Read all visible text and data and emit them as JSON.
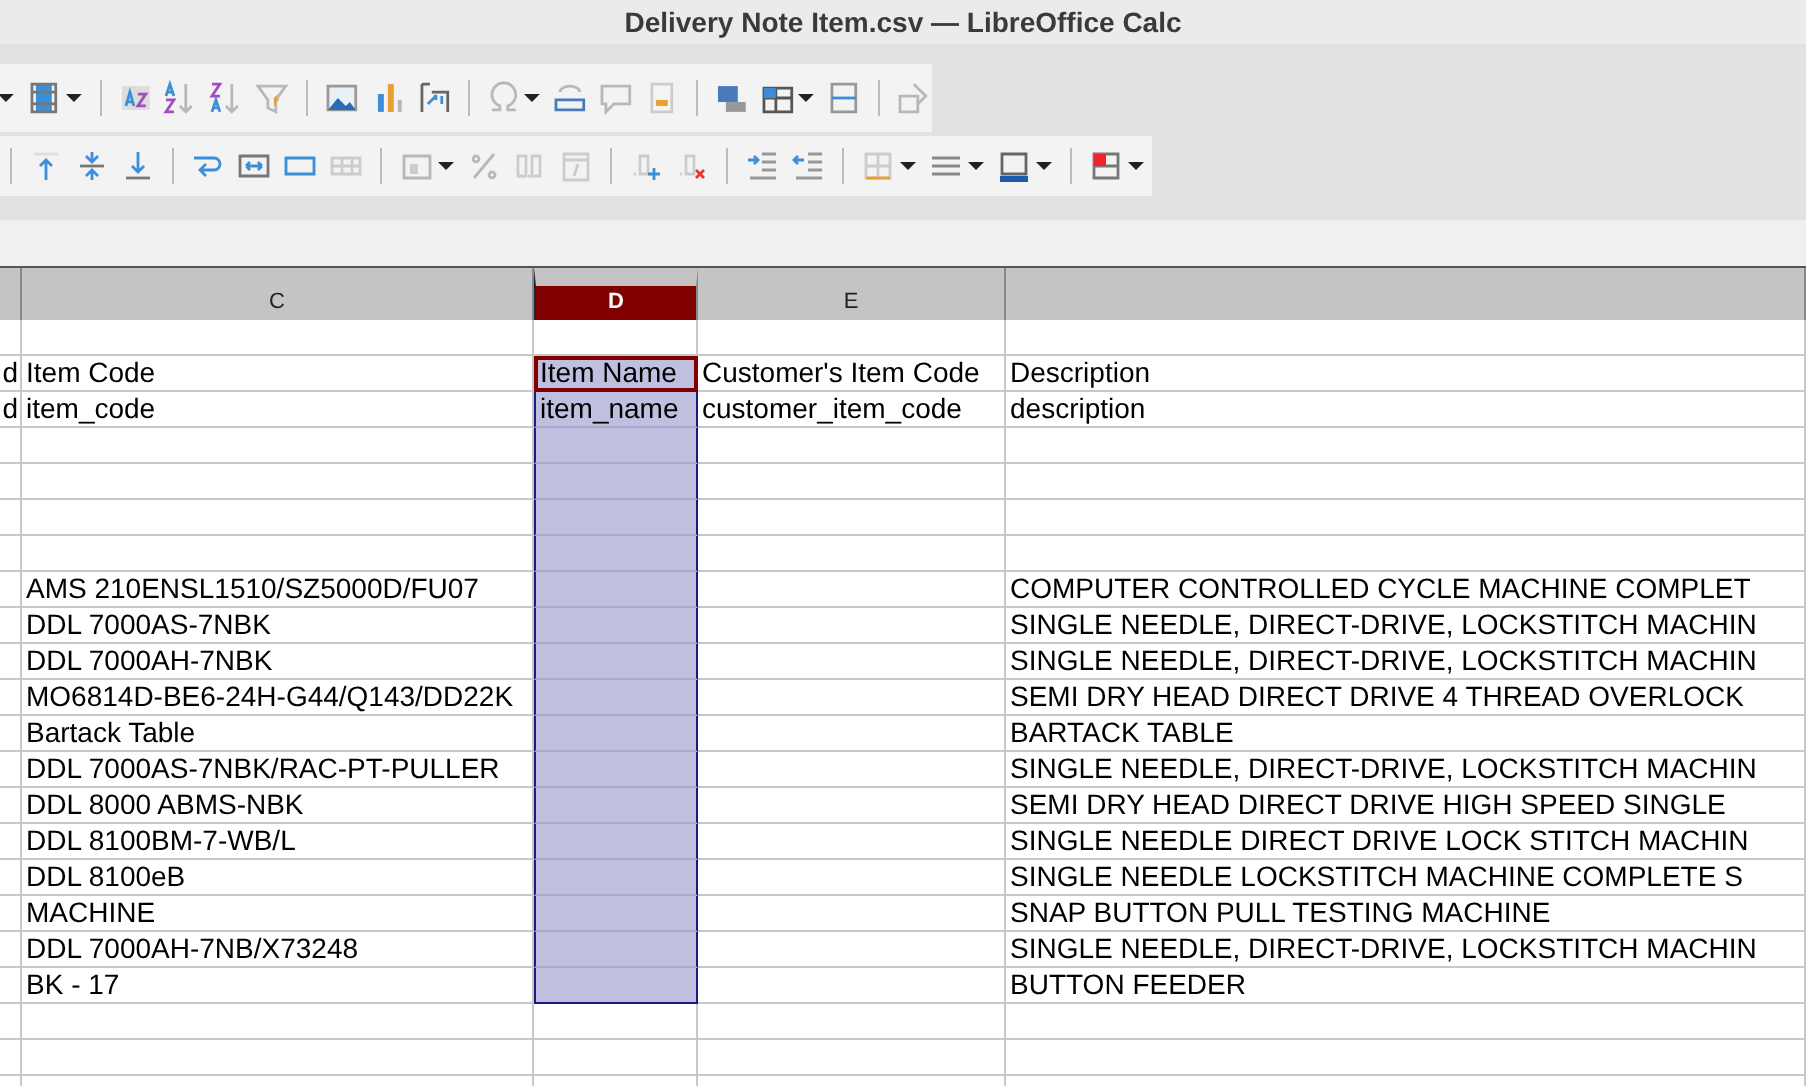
{
  "window": {
    "title": "Delivery Note Item.csv — LibreOffice Calc"
  },
  "sheet": {
    "columns": [
      {
        "selected": false
      },
      {
        "label": "C",
        "selected": false
      },
      {
        "label": "D",
        "selected": true
      },
      {
        "label": "E",
        "selected": false
      },
      {
        "selected": false
      }
    ],
    "rows": [
      {
        "selected": false,
        "active": false
      },
      {
        "selected": true,
        "active": true,
        "B": "d",
        "C": "Item Code",
        "D": "Item Name",
        "E": "Customer's Item Code",
        "F": "Description"
      },
      {
        "selected": true,
        "active": false,
        "B": "d",
        "C": "item_code",
        "D": "item_name",
        "E": "customer_item_code",
        "F": "description"
      },
      {
        "selected": true,
        "active": false
      },
      {
        "selected": true,
        "active": false
      },
      {
        "selected": true,
        "active": false
      },
      {
        "selected": true,
        "active": false
      },
      {
        "selected": true,
        "active": false,
        "C": "AMS 210ENSL1510/SZ5000D/FU07",
        "F": "COMPUTER CONTROLLED CYCLE MACHINE COMPLET"
      },
      {
        "selected": true,
        "active": false,
        "C": "DDL 7000AS-7NBK",
        "F": "SINGLE NEEDLE, DIRECT-DRIVE, LOCKSTITCH MACHIN"
      },
      {
        "selected": true,
        "active": false,
        "C": "DDL 7000AH-7NBK",
        "F": "SINGLE NEEDLE, DIRECT-DRIVE, LOCKSTITCH MACHIN"
      },
      {
        "selected": true,
        "active": false,
        "C": "MO6814D-BE6-24H-G44/Q143/DD22K",
        "F": "SEMI DRY HEAD DIRECT DRIVE 4 THREAD OVERLOCK"
      },
      {
        "selected": true,
        "active": false,
        "C": "Bartack Table",
        "F": "BARTACK TABLE"
      },
      {
        "selected": true,
        "active": false,
        "C": "DDL 7000AS-7NBK/RAC-PT-PULLER",
        "F": "SINGLE NEEDLE, DIRECT-DRIVE, LOCKSTITCH MACHIN"
      },
      {
        "selected": true,
        "active": false,
        "C": "DDL 8000 ABMS-NBK",
        "F": "SEMI DRY HEAD DIRECT DRIVE HIGH SPEED SINGLE"
      },
      {
        "selected": true,
        "active": false,
        "C": "DDL 8100BM-7-WB/L",
        "F": "SINGLE NEEDLE DIRECT DRIVE LOCK STITCH MACHIN"
      },
      {
        "selected": true,
        "active": false,
        "C": "DDL 8100eB",
        "F": "SINGLE NEEDLE LOCKSTITCH MACHINE COMPLETE S"
      },
      {
        "selected": true,
        "active": false,
        "C": "MACHINE",
        "F": "SNAP BUTTON PULL TESTING MACHINE"
      },
      {
        "selected": true,
        "active": false,
        "C": "DDL 7000AH-7NB/X73248",
        "F": "SINGLE NEEDLE, DIRECT-DRIVE, LOCKSTITCH MACHIN"
      },
      {
        "selected": true,
        "active": false,
        "C": "BK - 17",
        "F": "BUTTON FEEDER"
      },
      {
        "selected": false,
        "active": false
      }
    ]
  }
}
